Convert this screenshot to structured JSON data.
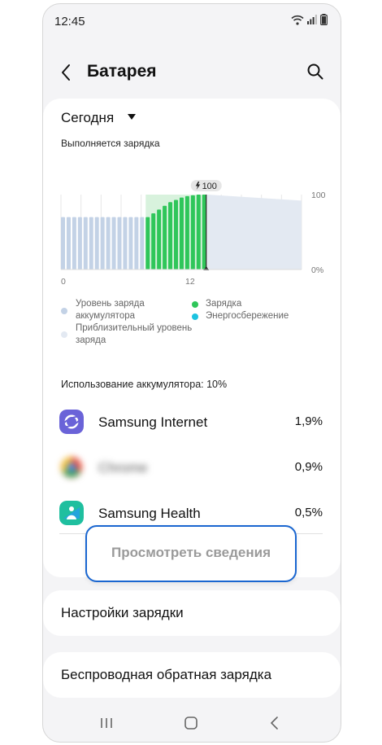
{
  "status": {
    "time": "12:45"
  },
  "header": {
    "title": "Батарея"
  },
  "period": {
    "label": "Сегодня"
  },
  "charging_status": "Выполняется зарядка",
  "chart_data": {
    "type": "bar",
    "badge": "100",
    "y_top_label": "100",
    "y_bottom_label": "0%",
    "x_labels": [
      "0",
      "12"
    ],
    "ylim": [
      0,
      100
    ],
    "bars": [
      {
        "v": 70,
        "kind": "level"
      },
      {
        "v": 70,
        "kind": "level"
      },
      {
        "v": 70,
        "kind": "level"
      },
      {
        "v": 70,
        "kind": "level"
      },
      {
        "v": 70,
        "kind": "level"
      },
      {
        "v": 70,
        "kind": "level"
      },
      {
        "v": 70,
        "kind": "level"
      },
      {
        "v": 70,
        "kind": "level"
      },
      {
        "v": 70,
        "kind": "level"
      },
      {
        "v": 70,
        "kind": "level"
      },
      {
        "v": 70,
        "kind": "level"
      },
      {
        "v": 70,
        "kind": "level"
      },
      {
        "v": 70,
        "kind": "level"
      },
      {
        "v": 70,
        "kind": "level"
      },
      {
        "v": 70,
        "kind": "level"
      },
      {
        "v": 70,
        "kind": "charge"
      },
      {
        "v": 75,
        "kind": "charge"
      },
      {
        "v": 80,
        "kind": "charge"
      },
      {
        "v": 85,
        "kind": "charge"
      },
      {
        "v": 90,
        "kind": "charge"
      },
      {
        "v": 93,
        "kind": "charge"
      },
      {
        "v": 96,
        "kind": "charge"
      },
      {
        "v": 98,
        "kind": "charge"
      },
      {
        "v": 99,
        "kind": "charge"
      },
      {
        "v": 100,
        "kind": "charge"
      },
      {
        "v": 100,
        "kind": "charge"
      }
    ],
    "projected_start": 100,
    "projected_end": 92
  },
  "legend": {
    "level": "Уровень заряда аккумулятора",
    "level_line1": "Уровень заряда",
    "level_line2": "аккумулятора",
    "approx_line1": "Приблизительный уровень",
    "approx_line2": "заряда",
    "charging": "Зарядка",
    "saving": "Энергосбережение",
    "colors": {
      "level": "#c3d2e6",
      "charging": "#2fc65a",
      "saving": "#1cc3e0",
      "approx": "#e3e9f2"
    }
  },
  "usage": {
    "title": "Использование аккумулятора: 10%"
  },
  "apps": [
    {
      "name": "Samsung Internet",
      "value": "1,9%",
      "icon": "samsung-internet-icon"
    },
    {
      "name": "Chrome",
      "value": "0,9%",
      "icon": "chrome-icon"
    },
    {
      "name": "Samsung Health",
      "value": "0,5%",
      "icon": "samsung-health-icon"
    }
  ],
  "details_button": {
    "label": "Просмотреть сведения"
  },
  "settings": [
    {
      "label": "Настройки зарядки"
    },
    {
      "label": "Беспроводная обратная зарядка"
    }
  ]
}
